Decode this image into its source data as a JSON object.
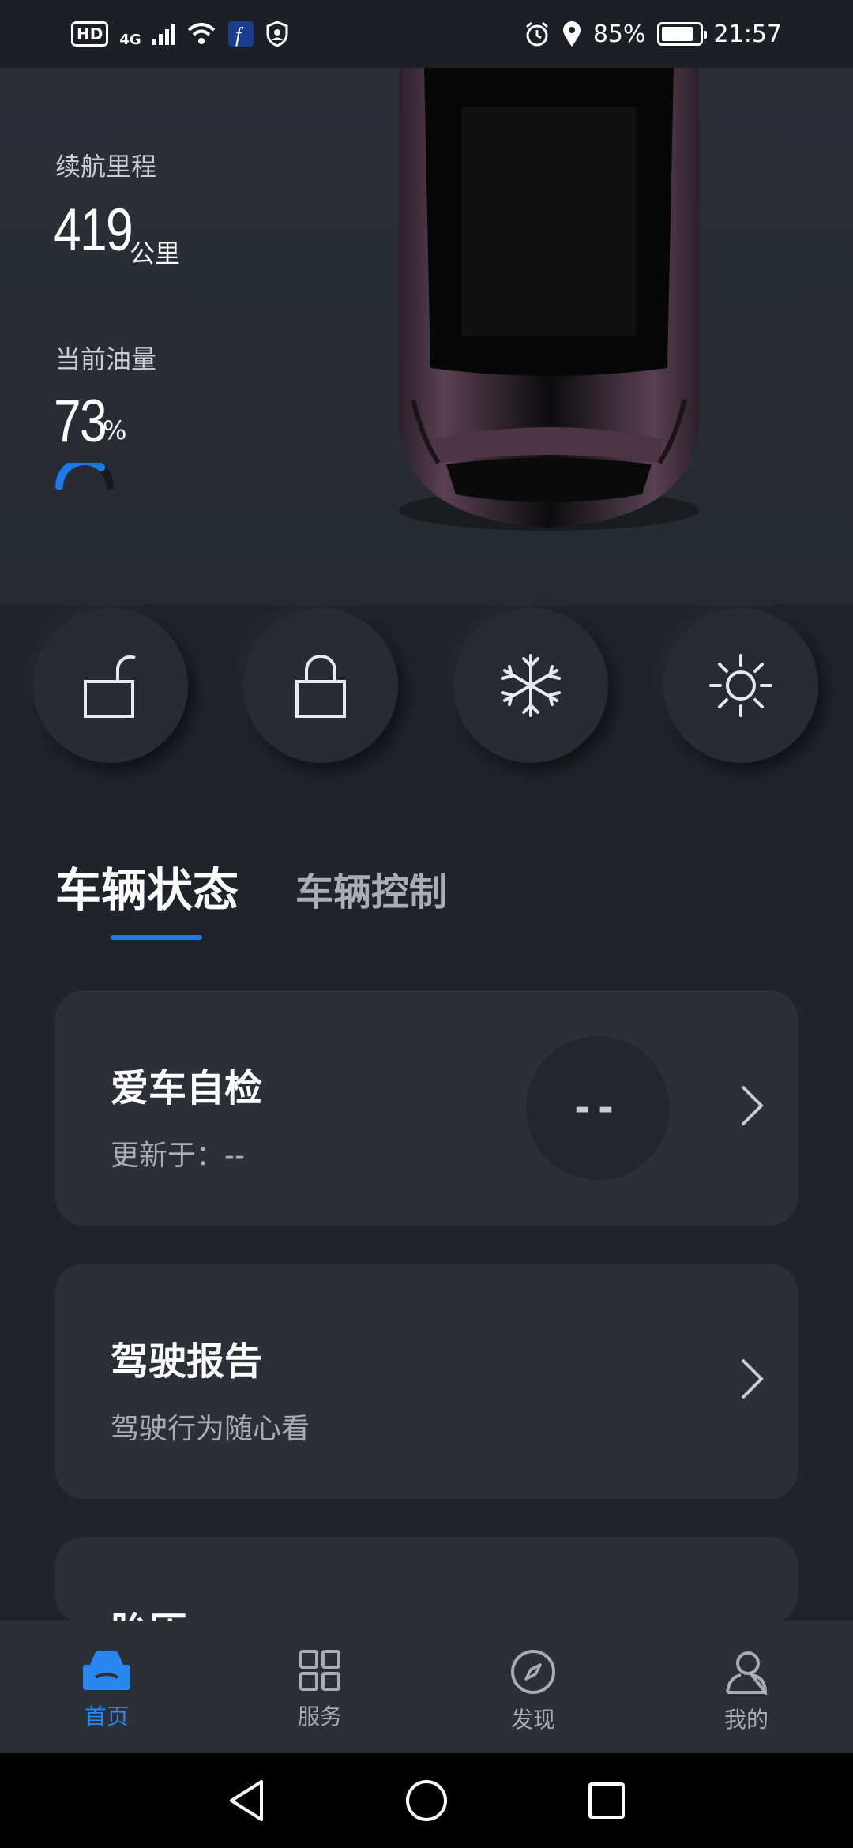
{
  "status_bar": {
    "hd": "HD",
    "network": "4G",
    "battery_percent": "85%",
    "battery_level": 0.85,
    "time": "21:57"
  },
  "vehicle": {
    "range_label": "续航里程",
    "range_value": "419",
    "range_unit": "公里",
    "fuel_label": "当前油量",
    "fuel_value": "73",
    "fuel_unit": "%",
    "fuel_level": 0.73,
    "car_color": "#3e2a38"
  },
  "quick_actions": [
    {
      "icon": "unlock-icon"
    },
    {
      "icon": "lock-icon"
    },
    {
      "icon": "snowflake-icon"
    },
    {
      "icon": "sun-icon"
    }
  ],
  "tabs": {
    "active": "车辆状态",
    "inactive": "车辆控制"
  },
  "cards": {
    "self_check": {
      "title": "爱车自检",
      "subtitle": "更新于：--",
      "score": "--"
    },
    "driving_report": {
      "title": "驾驶报告",
      "subtitle": "驾驶行为随心看"
    },
    "tire_pressure": {
      "title": "胎压"
    }
  },
  "bottom_nav": {
    "home": "首页",
    "services": "服务",
    "discover": "发现",
    "mine": "我的"
  },
  "colors": {
    "accent": "#1e7ae8",
    "background": "#1f242c",
    "card": "#2a2f38"
  }
}
